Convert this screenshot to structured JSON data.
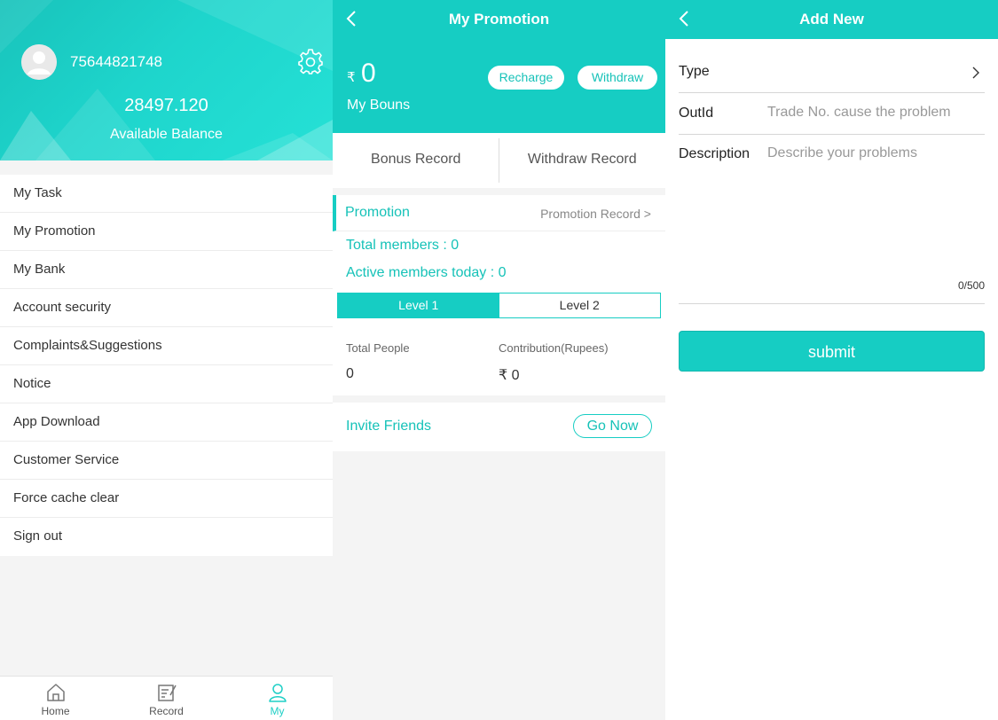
{
  "profile": {
    "phone": "75644821748",
    "balance": "28497.120",
    "balance_label": "Available Balance"
  },
  "menu": {
    "items": [
      "My Task",
      "My Promotion",
      "My Bank",
      "Account security",
      "Complaints&Suggestions",
      "Notice",
      "App Download",
      "Customer Service",
      "Force cache clear",
      "Sign out"
    ]
  },
  "tabbar": {
    "home": "Home",
    "record": "Record",
    "my": "My",
    "active": "My"
  },
  "promotion_page": {
    "title": "My Promotion",
    "currency": "₹",
    "bonus_value": "0",
    "bonus_label": "My Bouns",
    "recharge": "Recharge",
    "withdraw": "Withdraw",
    "bonus_record": "Bonus Record",
    "withdraw_record": "Withdraw Record",
    "promotion_title": "Promotion",
    "promotion_record": "Promotion Record >",
    "total_members": "Total members :  0",
    "active_members": "Active members today :  0",
    "level1": "Level 1",
    "level2": "Level 2",
    "selected_level": "Level 1",
    "col_people": "Total People",
    "col_contribution": "Contribution(Rupees)",
    "people_value": "0",
    "contribution_value": "₹ 0",
    "invite_label": "Invite Friends",
    "go_now": "Go Now"
  },
  "add_new_page": {
    "title": "Add New",
    "type_label": "Type",
    "outid_label": "OutId",
    "outid_placeholder": "Trade No. cause the problem",
    "description_label": "Description",
    "description_placeholder": "Describe your problems",
    "counter": "0/500",
    "submit": "submit"
  },
  "colors": {
    "accent": "#16cdc3",
    "background": "#f4f4f4"
  }
}
